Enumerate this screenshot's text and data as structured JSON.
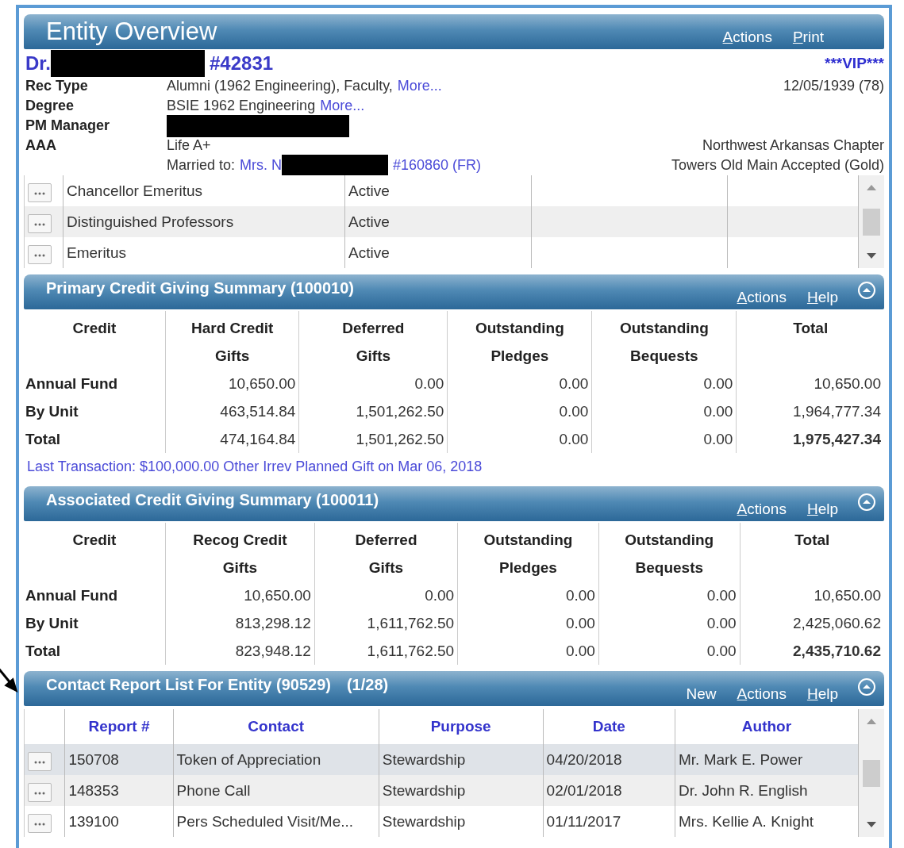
{
  "header": {
    "title": "Entity Overview",
    "links": [
      {
        "label": "Actions",
        "underline": true
      },
      {
        "label": "Print",
        "underline": true
      }
    ]
  },
  "entity": {
    "prefix": "Dr.",
    "id": "#42831",
    "badge": "***VIP***",
    "birth": "12/05/1939 (78)"
  },
  "fields": [
    {
      "label": "Rec Type",
      "value": "Alumni (1962 Engineering), Faculty,",
      "link": "More..."
    },
    {
      "label": "Degree",
      "value": "BSIE 1962 Engineering",
      "link": "More..."
    },
    {
      "label": "PM Manager",
      "redacted": true
    },
    {
      "label": "AAA",
      "value": "Life A+",
      "right": "Northwest Arkansas Chapter"
    }
  ],
  "spouse": {
    "label": "Married to:",
    "link": "Mrs. N",
    "id": "#160860 (FR)",
    "right": "Towers Old Main Accepted (Gold)"
  },
  "affiliations": [
    {
      "name": "Chancellor Emeritus",
      "status": "Active"
    },
    {
      "name": "Distinguished Professors",
      "status": "Active"
    },
    {
      "name": "Emeritus",
      "status": "Active"
    }
  ],
  "summaries": [
    {
      "title": "Primary Credit Giving Summary (100010)",
      "links": [
        {
          "label": "Actions",
          "underline": true
        },
        {
          "label": "Help",
          "underline": true
        }
      ],
      "columns": [
        "Credit",
        "Hard Credit\nGifts",
        "Deferred\nGifts",
        "Outstanding\nPledges",
        "Outstanding\nBequests",
        "Total"
      ],
      "rows": [
        {
          "label": "Annual Fund",
          "kind": "normal",
          "values": [
            "10,650.00",
            "0.00",
            "0.00",
            "0.00",
            "10,650.00"
          ]
        },
        {
          "label": "By Unit",
          "kind": "normal",
          "values": [
            "463,514.84",
            "1,501,262.50",
            "0.00",
            "0.00",
            "1,964,777.34"
          ]
        },
        {
          "label": "Total",
          "kind": "total",
          "values": [
            "474,164.84",
            "1,501,262.50",
            "0.00",
            "0.00",
            "1,975,427.34"
          ]
        }
      ],
      "footer": "Last Transaction: $100,000.00 Other Irrev Planned Gift on Mar 06, 2018"
    },
    {
      "title": "Associated Credit Giving Summary (100011)",
      "links": [
        {
          "label": "Actions",
          "underline": true
        },
        {
          "label": "Help",
          "underline": true
        }
      ],
      "columns": [
        "Credit",
        "Recog Credit\nGifts",
        "Deferred\nGifts",
        "Outstanding\nPledges",
        "Outstanding\nBequests",
        "Total"
      ],
      "rows": [
        {
          "label": "Annual Fund",
          "kind": "normal",
          "values": [
            "10,650.00",
            "0.00",
            "0.00",
            "0.00",
            "10,650.00"
          ]
        },
        {
          "label": "By Unit",
          "kind": "normal",
          "values": [
            "813,298.12",
            "1,611,762.50",
            "0.00",
            "0.00",
            "2,425,060.62"
          ]
        },
        {
          "label": "Total",
          "kind": "total",
          "values": [
            "823,948.12",
            "1,611,762.50",
            "0.00",
            "0.00",
            "2,435,710.62"
          ]
        }
      ]
    }
  ],
  "contacts": {
    "title": "Contact Report List For Entity (90529)",
    "count": "(1/28)",
    "links": [
      {
        "label": "New",
        "underline": false
      },
      {
        "label": "Actions",
        "underline": true
      },
      {
        "label": "Help",
        "underline": true
      }
    ],
    "columns": [
      "Report #",
      "Contact",
      "Purpose",
      "Date",
      "Author"
    ],
    "rows": [
      {
        "selected": true,
        "cells": [
          "150708",
          "Token of Appreciation",
          "Stewardship",
          "04/20/2018",
          "Mr. Mark E. Power"
        ]
      },
      {
        "selected": false,
        "cells": [
          "148353",
          "Phone Call",
          "Stewardship",
          "02/01/2018",
          "Dr. John R. English"
        ]
      },
      {
        "selected": false,
        "cells": [
          "139100",
          "Pers Scheduled Visit/Me...",
          "Stewardship",
          "01/11/2017",
          "Mrs. Kellie A. Knight"
        ]
      }
    ]
  }
}
